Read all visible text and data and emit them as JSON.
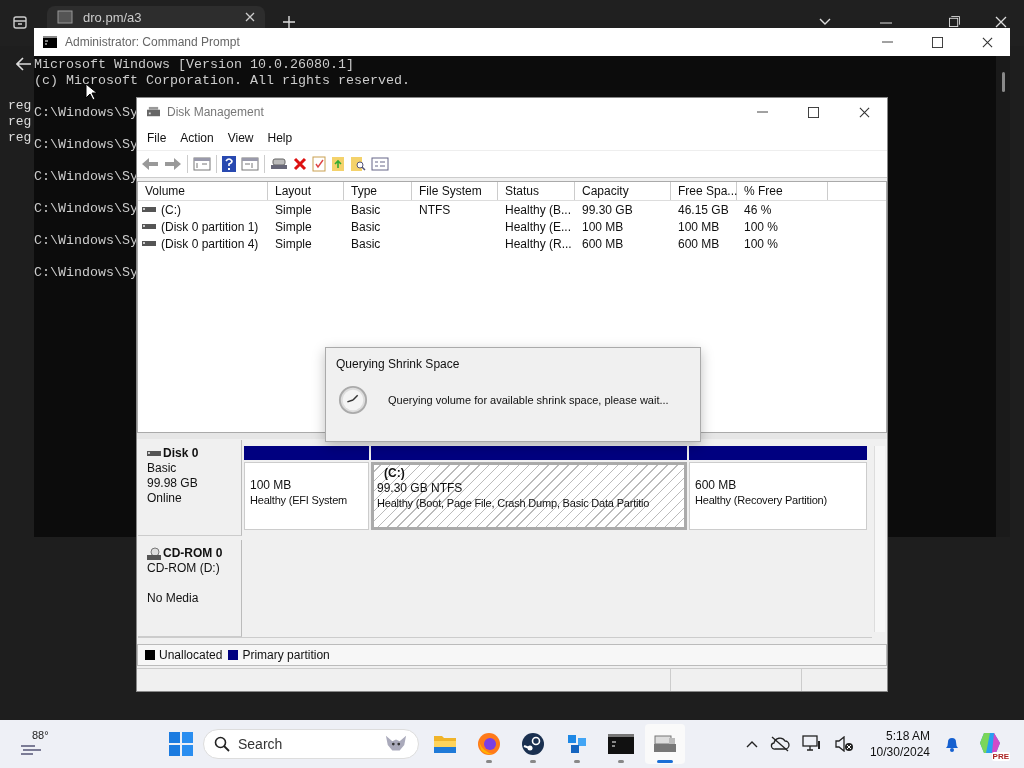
{
  "browser": {
    "tab": {
      "title": "dro.pm/a3"
    },
    "side_lines": [
      "reg",
      "reg",
      "reg"
    ]
  },
  "cmd": {
    "title": "Administrator: Command Prompt",
    "header_lines": [
      "Microsoft Windows [Version 10.0.26080.1]",
      "(c) Microsoft Corporation. All rights reserved."
    ],
    "prompts": [
      "C:\\Windows\\Sy",
      "C:\\Windows\\Sy",
      "C:\\Windows\\Sy",
      "C:\\Windows\\Sy",
      "C:\\Windows\\Sy",
      "C:\\Windows\\Sy"
    ]
  },
  "disk_management": {
    "title": "Disk Management",
    "menu": [
      "File",
      "Action",
      "View",
      "Help"
    ],
    "table": {
      "columns": [
        "Volume",
        "Layout",
        "Type",
        "File System",
        "Status",
        "Capacity",
        "Free Spa...",
        "% Free"
      ],
      "rows": [
        {
          "cells": [
            "(C:)",
            "Simple",
            "Basic",
            "NTFS",
            "Healthy (B...",
            "99.30 GB",
            "46.15 GB",
            "46 %"
          ]
        },
        {
          "cells": [
            "(Disk 0 partition 1)",
            "Simple",
            "Basic",
            "",
            "Healthy (E...",
            "100 MB",
            "100 MB",
            "100 %"
          ]
        },
        {
          "cells": [
            "(Disk 0 partition 4)",
            "Simple",
            "Basic",
            "",
            "Healthy (R...",
            "600 MB",
            "600 MB",
            "100 %"
          ]
        }
      ]
    },
    "dialog": {
      "title": "Querying Shrink Space",
      "message": "Querying volume for available shrink space, please wait..."
    },
    "disks": [
      {
        "kind": "disk",
        "name": "Disk 0",
        "details": [
          "Basic",
          "99.98 GB",
          "Online"
        ],
        "partitions": [
          {
            "size": "100 MB",
            "status": "Healthy (EFI System",
            "selected": false
          },
          {
            "label": "(C:)",
            "size": "99.30 GB NTFS",
            "status": "Healthy (Boot, Page File, Crash Dump, Basic Data Partitio",
            "selected": true
          },
          {
            "size": "600 MB",
            "status": "Healthy (Recovery Partition)",
            "selected": false
          }
        ]
      },
      {
        "kind": "cdrom",
        "name": "CD-ROM 0",
        "details": [
          "CD-ROM (D:)",
          "No Media"
        ]
      }
    ],
    "legend": [
      {
        "label": "Unallocated",
        "color": "#000000"
      },
      {
        "label": "Primary partition",
        "color": "#000080"
      }
    ]
  },
  "taskbar": {
    "weather": "88°",
    "search": {
      "placeholder": "Search"
    },
    "apps": [
      {
        "kind": "folder",
        "running": false,
        "active": false
      },
      {
        "kind": "firefox",
        "running": true,
        "active": false
      },
      {
        "kind": "steam",
        "running": true,
        "active": false
      },
      {
        "kind": "blocks",
        "running": true,
        "active": false
      },
      {
        "kind": "terminal",
        "running": true,
        "active": false
      },
      {
        "kind": "diskmgmt",
        "running": true,
        "active": true
      }
    ],
    "clock": {
      "time": "5:18 AM",
      "date": "10/30/2024"
    },
    "copilot_badge": "PRE"
  }
}
